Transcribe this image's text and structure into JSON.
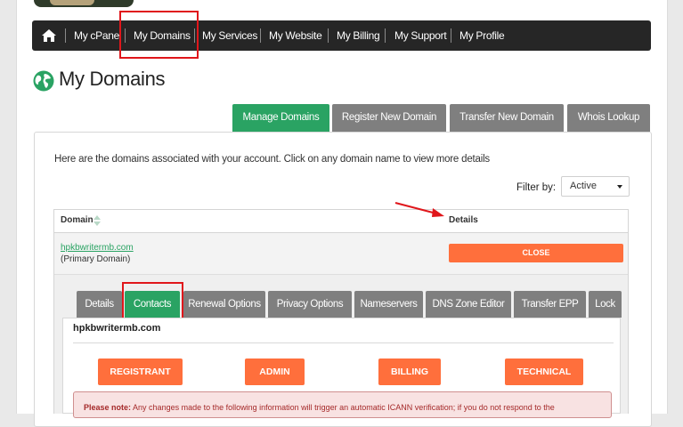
{
  "nav": {
    "home_icon": "home-icon",
    "items": [
      "My cPanel",
      "My Domains",
      "My Services",
      "My Website",
      "My Billing",
      "My Support",
      "My Profile"
    ]
  },
  "page": {
    "title": "My Domains",
    "icon": "globe-icon"
  },
  "tabs": [
    "Manage Domains",
    "Register New Domain",
    "Transfer New Domain",
    "Whois Lookup"
  ],
  "intro_text": "Here are the domains associated with your account. Click on any domain name to view more details",
  "filter": {
    "label": "Filter by:",
    "selected": "Active"
  },
  "table": {
    "headers": {
      "domain": "Domain",
      "details": "Details"
    },
    "row": {
      "domain": "hpkbwritermb.com",
      "note": "(Primary Domain)",
      "action": "CLOSE"
    }
  },
  "subtabs": [
    "Details",
    "Contacts",
    "Renewal Options",
    "Privacy Options",
    "Nameservers",
    "DNS Zone Editor",
    "Transfer EPP",
    "Lock"
  ],
  "contacts": {
    "domain": "hpkbwritermb.com",
    "roles": [
      "REGISTRANT",
      "ADMIN",
      "BILLING",
      "TECHNICAL"
    ],
    "note_label": "Please note:",
    "note_text": "Any changes made to the following information will trigger an automatic ICANN verification; if you do not respond to the"
  },
  "colors": {
    "nav_bg": "#262626",
    "active_green": "#2aa363",
    "tab_gray": "#7f7f7f",
    "accent_orange": "#ff6f3c",
    "highlight_red": "#e0161b"
  }
}
